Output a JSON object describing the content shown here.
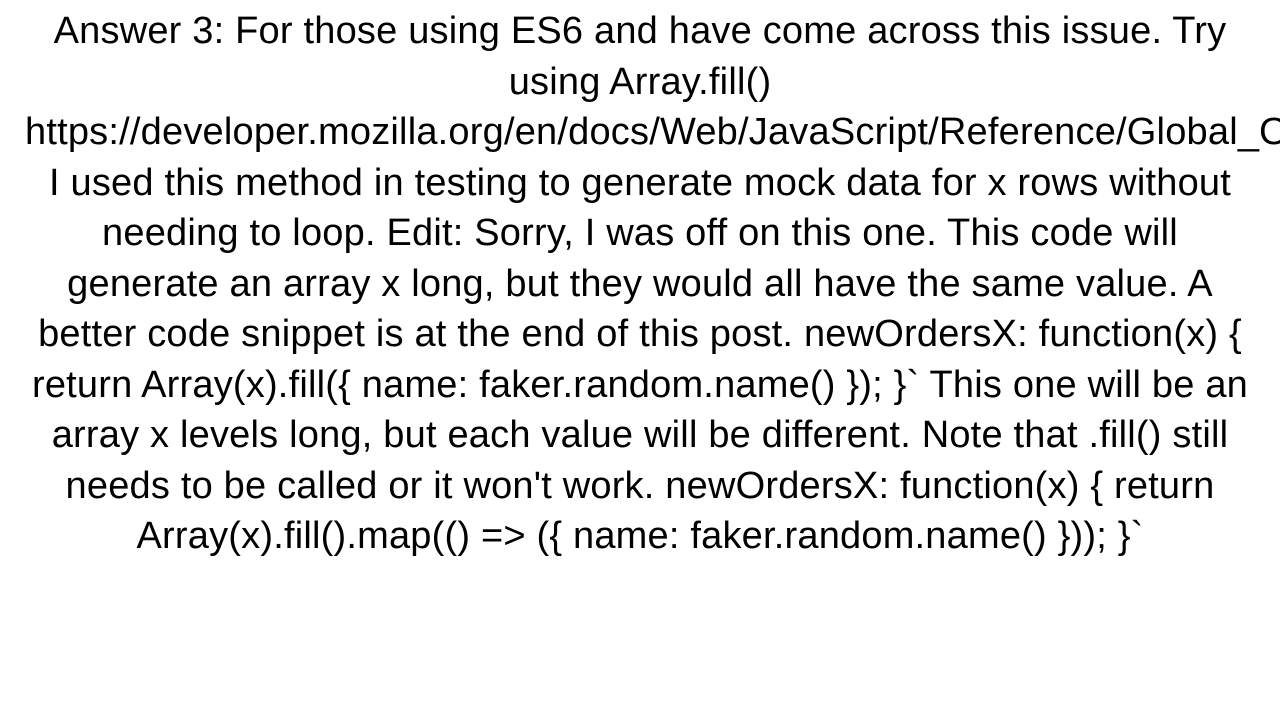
{
  "answer": {
    "text": "Answer 3: For those using ES6 and have come across this issue. Try using Array.fill() https://developer.mozilla.org/en/docs/Web/JavaScript/Reference/Global_Objects/Array/fill I used this method in testing to generate mock data for x rows without needing to loop. Edit: Sorry, I was off on this one. This code will generate an array x long, but they would all have the same value. A better code snippet is at the end of this post. newOrdersX: function(x) {   return Array(x).fill({     name: faker.random.name()   }); }`  This one will be an array x levels long, but each value will be different. Note that .fill() still needs to be called or it won't work. newOrdersX: function(x) {   return Array(x).fill().map(() => ({     name: faker.random.name()   })); }`"
  }
}
